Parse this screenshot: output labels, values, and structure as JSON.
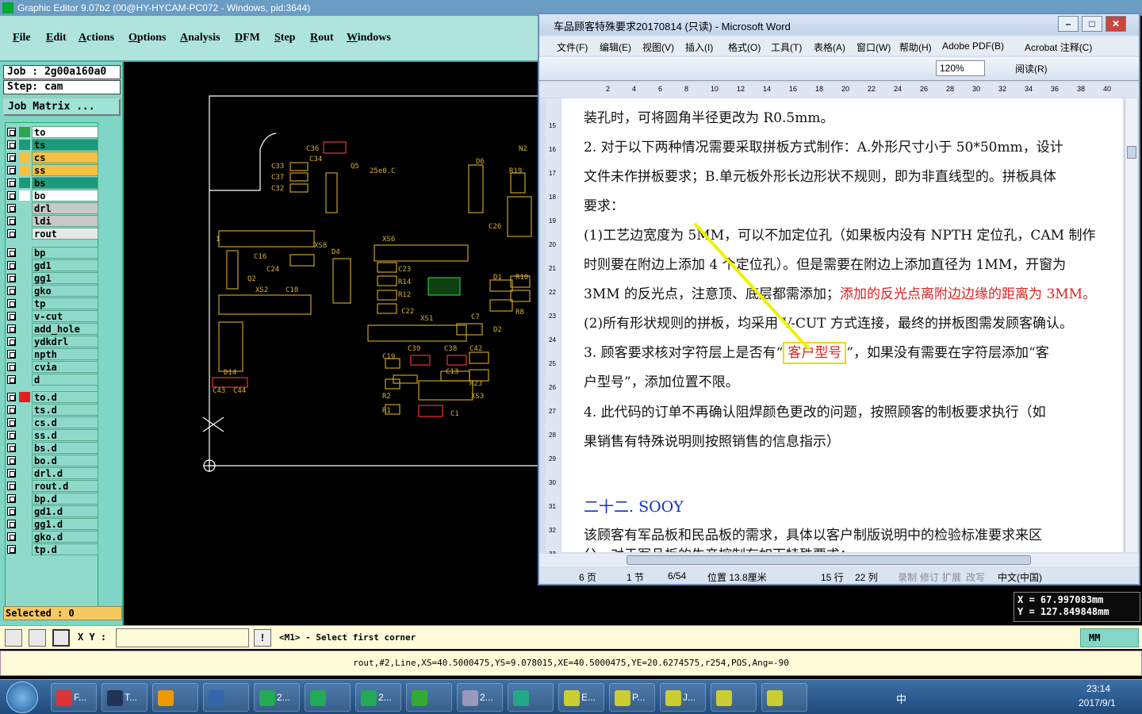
{
  "ge": {
    "title": "Graphic Editor 9.07b2 (00@HY-HYCAM-PC072 - Windows, pid:3644)",
    "menu": [
      "File",
      "Edit",
      "Actions",
      "Options",
      "Analysis",
      "DFM",
      "Step",
      "Rout",
      "Windows"
    ],
    "job": "Job : 2g00a160a0",
    "step": "Step: cam",
    "job_matrix": "Job Matrix ...",
    "layers": [
      {
        "name": "to",
        "color": "#ffffff",
        "swatch": "#2ea44f"
      },
      {
        "name": "ts",
        "color": "#1a9a7a",
        "swatch": "#1a9a7a"
      },
      {
        "name": "cs",
        "color": "#f8c040",
        "swatch": "#f8c040"
      },
      {
        "name": "ss",
        "color": "#f8c040",
        "swatch": "#f8c040"
      },
      {
        "name": "bs",
        "color": "#1a9a7a",
        "swatch": "#1a9a7a"
      },
      {
        "name": "bo",
        "color": "#ffffff",
        "swatch": "#ffffff"
      },
      {
        "name": "drl",
        "color": "#c8c8c8",
        "swatch": "#8fd9cb"
      },
      {
        "name": "ldi",
        "color": "#c8c8c8",
        "swatch": "#8fd9cb"
      },
      {
        "name": "rout",
        "color": "#e8e8e8",
        "swatch": "#8fd9cb"
      },
      {
        "name": "bp",
        "color": "#8fd9cb",
        "swatch": "#8fd9cb"
      },
      {
        "name": "gd1",
        "color": "#8fd9cb",
        "swatch": "#8fd9cb"
      },
      {
        "name": "gg1",
        "color": "#8fd9cb",
        "swatch": "#8fd9cb"
      },
      {
        "name": "gko",
        "color": "#8fd9cb",
        "swatch": "#8fd9cb"
      },
      {
        "name": "tp",
        "color": "#8fd9cb",
        "swatch": "#8fd9cb"
      },
      {
        "name": "v-cut",
        "color": "#8fd9cb",
        "swatch": "#8fd9cb"
      },
      {
        "name": "add_hole",
        "color": "#8fd9cb",
        "swatch": "#8fd9cb"
      },
      {
        "name": "ydkdrl",
        "color": "#8fd9cb",
        "swatch": "#8fd9cb"
      },
      {
        "name": "npth",
        "color": "#8fd9cb",
        "swatch": "#8fd9cb"
      },
      {
        "name": "cvia",
        "color": "#8fd9cb",
        "swatch": "#8fd9cb"
      },
      {
        "name": "d",
        "color": "#8fd9cb",
        "swatch": "#8fd9cb"
      },
      {
        "name": "to.d",
        "color": "#8fd9cb",
        "swatch": "#e02020"
      },
      {
        "name": "ts.d",
        "color": "#8fd9cb",
        "swatch": "#8fd9cb"
      },
      {
        "name": "cs.d",
        "color": "#8fd9cb",
        "swatch": "#8fd9cb"
      },
      {
        "name": "ss.d",
        "color": "#8fd9cb",
        "swatch": "#8fd9cb"
      },
      {
        "name": "bs.d",
        "color": "#8fd9cb",
        "swatch": "#8fd9cb"
      },
      {
        "name": "bo.d",
        "color": "#8fd9cb",
        "swatch": "#8fd9cb"
      },
      {
        "name": "drl.d",
        "color": "#8fd9cb",
        "swatch": "#8fd9cb"
      },
      {
        "name": "rout.d",
        "color": "#8fd9cb",
        "swatch": "#8fd9cb"
      },
      {
        "name": "bp.d",
        "color": "#8fd9cb",
        "swatch": "#8fd9cb"
      },
      {
        "name": "gd1.d",
        "color": "#8fd9cb",
        "swatch": "#8fd9cb"
      },
      {
        "name": "gg1.d",
        "color": "#8fd9cb",
        "swatch": "#8fd9cb"
      },
      {
        "name": "gko.d",
        "color": "#8fd9cb",
        "swatch": "#8fd9cb"
      },
      {
        "name": "tp.d",
        "color": "#8fd9cb",
        "swatch": "#8fd9cb"
      }
    ],
    "selected": "Selected : 0",
    "pcb_labels": [
      "C36",
      "C33",
      "C37",
      "C32",
      "C34",
      "Q5",
      "25e0.C",
      "D6",
      "N2",
      "R19",
      "C26",
      "XS6",
      "XS8",
      "C16",
      "C24",
      "D4",
      "C23",
      "R14",
      "R12",
      "Q2",
      "XS2",
      "C18",
      "XS1",
      "C22",
      "C7",
      "D1",
      "R10",
      "R8",
      "D2",
      "C19",
      "C39",
      "C38",
      "C42",
      "C13",
      "R23",
      "R2",
      "R1",
      "XS3",
      "C1",
      "D14",
      "C43",
      "C44",
      "1"
    ],
    "coord_x": "X  =  67.997083mm",
    "coord_y": "Y  = 127.849848mm",
    "xy_label": "X Y :",
    "xy_value": "",
    "prompt": "<M1> - Select first corner",
    "units": "MM",
    "status_line": "rout,#2,Line,XS=40.5000475,YS=9.078015,XE=40.5000475,YE=20.6274575,r254,POS,Ang=-90"
  },
  "word": {
    "title": "车品顾客特殊要求20170814 (只读) - Microsoft Word",
    "menu": [
      "文件(F)",
      "编辑(E)",
      "视图(V)",
      "插入(I)",
      "格式(O)",
      "工具(T)",
      "表格(A)",
      "窗口(W)",
      "帮助(H)",
      "Adobe PDF(B)",
      "Acrobat 注释(C)"
    ],
    "zoom": "120%",
    "read_mode": "阅读(R)",
    "paragraphs": [
      "装孔时，可将圆角半径更改为 R0.5mm。",
      "2. 对于以下两种情况需要采取拼板方式制作：A.外形尺寸小于 50*50mm，设计",
      "文件未作拼板要求；B.单元板外形长边形状不规则，即为非直线型的。拼板具体",
      "要求：",
      "(1)工艺边宽度为 5MM，可以不加定位孔（如果板内没有 NPTH 定位孔，CAM 制作",
      "时则要在附边上添加 4 个定位孔）。但是需要在附边上添加直径为 1MM，开窗为",
      "3MM 的反光点，注意顶、底层都需添加；",
      "(2)所有形状规则的拼板，均采用 V-CUT 方式连接，最终的拼板图需发顾客确认。",
      "3. 顾客要求核对字符层上是否有“",
      "”，如果没有需要在字符层添加“客",
      "户型号”，添加位置不限。",
      "4. 此代码的订单不再确认阻焊颜色更改的问题，按照顾客的制板要求执行（如",
      "果销售有特殊说明则按照销售的信息指示）",
      "该顾客有军品板和民品板的需求，具体以客户制版说明中的检验标准要求来区",
      "分。对于军品板的生产控制有如下特殊要求："
    ],
    "red_text": "添加的反光点离附边边缘的距离为 3MM。",
    "highlight": "客户型号",
    "heading": "二十二. SOOY",
    "status": [
      "6 页",
      "1 节",
      "6/54",
      "位置 13.8厘米",
      "15 行",
      "22 列",
      "录制",
      "修订",
      "扩展",
      "改写",
      "中文(中国)"
    ]
  },
  "taskbar": {
    "items": [
      "F...",
      "T...",
      "",
      "",
      "2...",
      "",
      "2...",
      "",
      "2...",
      "",
      "E...",
      "P...",
      "J...",
      "",
      ""
    ],
    "time": "23:14",
    "date": "2017/9/1",
    "ime": "中"
  }
}
